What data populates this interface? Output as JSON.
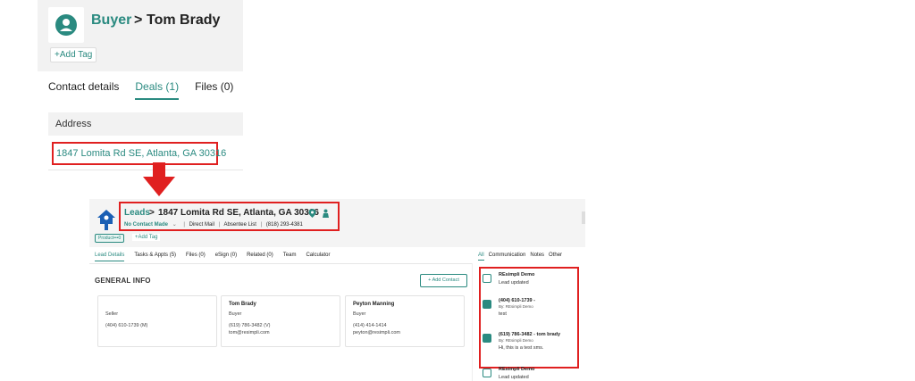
{
  "contact": {
    "breadcrumb_parent": "Buyer",
    "breadcrumb_separator": ">",
    "name": "Tom Brady",
    "add_tag": "+Add Tag",
    "tabs": [
      "Contact details",
      "Deals (1)",
      "Files (0)"
    ],
    "active_tab": "Deals (1)",
    "address_header": "Address",
    "address": "1847 Lomita Rd SE, Atlanta, GA 30316"
  },
  "lead": {
    "breadcrumb_parent": "Leads",
    "breadcrumb_separator": ">",
    "address": "1847 Lomita Rd SE, Atlanta, GA 30316",
    "status": "No Contact Made",
    "source": "Direct Mail",
    "list": "Absentee List",
    "phone": "(818) 293-4381",
    "product_tag": "Product•••0",
    "add_tag": "+Add Tag",
    "tabs": [
      "Lead Details",
      "Tasks & Appts (5)",
      "Files (0)",
      "eSign (0)",
      "Related (0)",
      "Team",
      "Calculator"
    ],
    "active_tab": "Lead Details",
    "section_title": "GENERAL INFO",
    "add_contact": "+ Add Contact",
    "cards": [
      {
        "name": "",
        "role": "Seller",
        "phone": "(404) 610-1739  (M)",
        "email": ""
      },
      {
        "name": "Tom Brady",
        "role": "Buyer",
        "phone": "(619) 786-3482  (V)",
        "email": "tom@resimpli.com"
      },
      {
        "name": "Peyton Manning",
        "role": "Buyer",
        "phone": "(414) 414-1414",
        "email": "peyton@resimpli.com"
      }
    ]
  },
  "activity": {
    "tabs": [
      "All",
      "Communication",
      "Notes",
      "Other"
    ],
    "active_tab": "All",
    "items": [
      {
        "icon": "update-icon",
        "title": "REsimpli Demo",
        "by": "",
        "body": "Lead updated"
      },
      {
        "icon": "message-icon",
        "title": "(404) 610-1739 -",
        "by": "By: REsimpli Demo",
        "body": "test"
      },
      {
        "icon": "message-icon",
        "title": "(619) 786-3482 - tom brady",
        "by": "By: REsimpli Demo",
        "body": "Hi, this is a test sms."
      },
      {
        "icon": "update-icon",
        "title": "REsimpli Demo",
        "by": "",
        "body": "Lead updated"
      }
    ]
  },
  "colors": {
    "accent": "#2a8a80",
    "highlight": "#e02020"
  }
}
